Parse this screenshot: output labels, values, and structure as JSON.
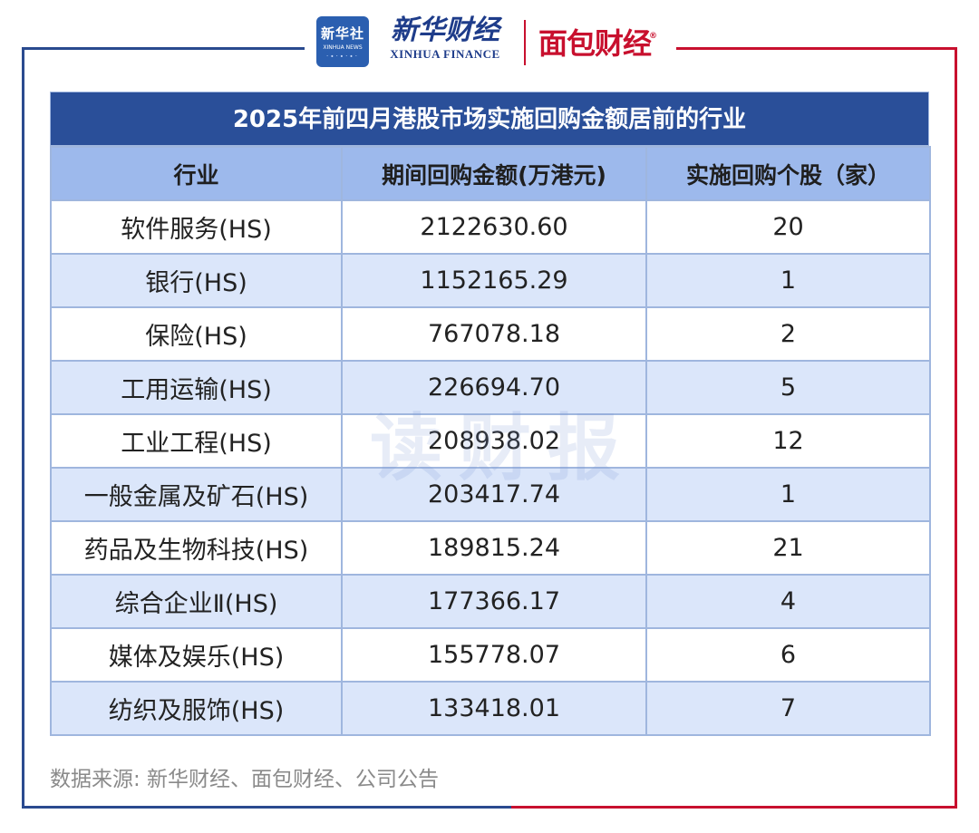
{
  "header": {
    "xinhua_badge_cn": "新华社",
    "xinhua_badge_en": "XINHUA NEWS",
    "xinhua_finance_cn": "新华财经",
    "xinhua_finance_en": "XINHUA FINANCE",
    "mianbao_logo": "面包财经",
    "registered_mark": "®"
  },
  "colors": {
    "title_bg": "#2a4f99",
    "header_bg": "#9db9ec",
    "row_alt_bg": "#dbe6fa",
    "frame_blue": "#2a4a8f",
    "frame_red": "#c8102e"
  },
  "table": {
    "title": "2025年前四月港股市场实施回购金额居前的行业",
    "headers": [
      "行业",
      "期间回购金额(万港元)",
      "实施回购个股（家）"
    ],
    "rows": [
      [
        "软件服务(HS)",
        "2122630.60",
        "20"
      ],
      [
        "银行(HS)",
        "1152165.29",
        "1"
      ],
      [
        "保险(HS)",
        "767078.18",
        "2"
      ],
      [
        "工用运输(HS)",
        "226694.70",
        "5"
      ],
      [
        "工业工程(HS)",
        "208938.02",
        "12"
      ],
      [
        "一般金属及矿石(HS)",
        "203417.74",
        "1"
      ],
      [
        "药品及生物科技(HS)",
        "189815.24",
        "21"
      ],
      [
        "综合企业Ⅱ(HS)",
        "177366.17",
        "4"
      ],
      [
        "媒体及娱乐(HS)",
        "155778.07",
        "6"
      ],
      [
        "纺织及服饰(HS)",
        "133418.01",
        "7"
      ]
    ]
  },
  "watermark": "读财报",
  "source": "数据来源: 新华财经、面包财经、公司公告"
}
